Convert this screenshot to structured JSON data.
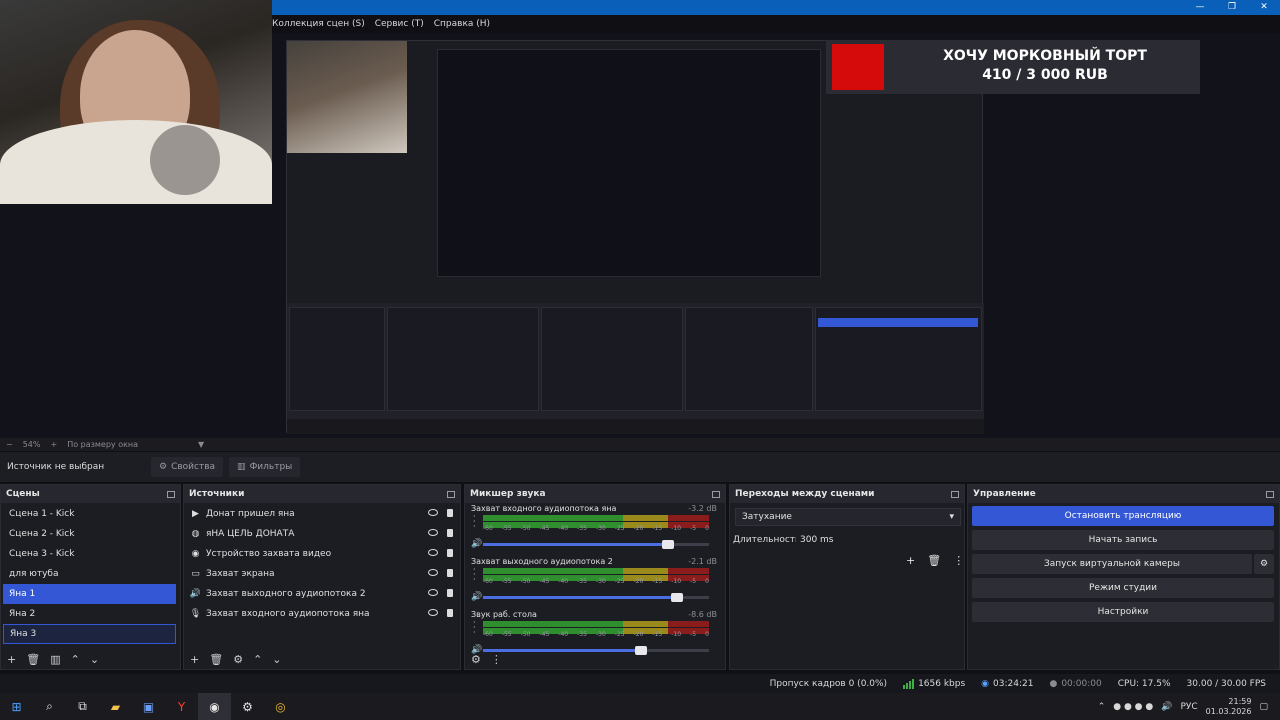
{
  "window": {
    "controls": [
      "—",
      "❐",
      "✕"
    ]
  },
  "menu": [
    "Коллекция сцен (S)",
    "Сервис (T)",
    "Справка (H)"
  ],
  "preview": {
    "donation": {
      "line1": "ХОЧУ МОРКОВНЫЙ ТОРТ",
      "line2": "410 / 3 000 RUB"
    }
  },
  "zoombar": {
    "zoom": "54%",
    "fit": "По размеру окна"
  },
  "context": {
    "source": "Источник не выбран",
    "properties": "Свойства",
    "filters": "Фильтры"
  },
  "docks": {
    "scenes": {
      "title": "Сцены",
      "items": [
        "Сцена 1 - Kick",
        "Сцена 2 - Kick",
        "Сцена 3 -  Kick",
        "для ютуба",
        "Яна 1",
        "Яна 2",
        "Яна 3"
      ]
    },
    "sources": {
      "title": "Источники",
      "items": [
        {
          "icon": "media",
          "label": "Донат пришел яна"
        },
        {
          "icon": "browser",
          "label": "яНА ЦЕЛЬ ДОНАТА"
        },
        {
          "icon": "camera",
          "label": "Устройство захвата видео"
        },
        {
          "icon": "display",
          "label": "Захват экрана"
        },
        {
          "icon": "speaker",
          "label": "Захват выходного аудиопотока 2"
        },
        {
          "icon": "mic",
          "label": "Захват входного аудиопотока яна"
        }
      ]
    },
    "mixer": {
      "title": "Микшер звука",
      "channels": [
        {
          "name": "Захват входного аудиопотока яна",
          "db": "-3.2 dB",
          "volume": 0.82
        },
        {
          "name": "Захват выходного аудиопотока 2",
          "db": "-2.1 dB",
          "volume": 0.86
        },
        {
          "name": "Звук раб. стола",
          "db": "-8.6 dB",
          "volume": 0.7
        }
      ],
      "scale": [
        "-60",
        "-55",
        "-50",
        "-45",
        "-40",
        "-35",
        "-30",
        "-25",
        "-20",
        "-15",
        "-10",
        "-5",
        "0"
      ]
    },
    "transitions": {
      "title": "Переходы между сценами",
      "selected": "Затухание",
      "duration_label": "Длительность",
      "duration": "300 ms"
    },
    "controls": {
      "title": "Управление",
      "buttons": [
        "Остановить трансляцию",
        "Начать запись",
        "Запуск виртуальной камеры",
        "Режим студии",
        "Настройки"
      ]
    }
  },
  "status": {
    "dropped": "Пропуск кадров 0 (0.0%)",
    "bitrate": "1656 kbps",
    "stream_time": "03:24:21",
    "rec_time": "00:00:00",
    "cpu": "CPU: 17.5%",
    "fps": "30.00 / 30.00 FPS"
  },
  "taskbar": {
    "lang": "РУС",
    "time": "21:59",
    "date": "01.03.2026"
  }
}
